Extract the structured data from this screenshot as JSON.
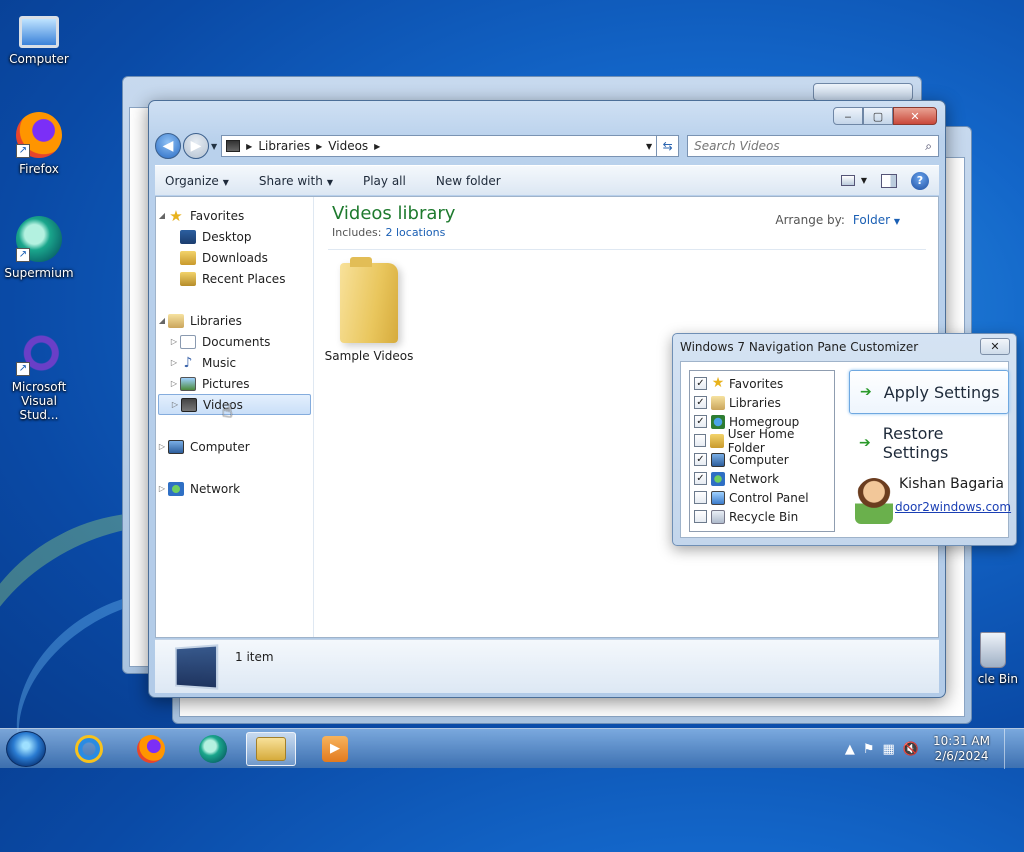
{
  "desktop": {
    "icons": [
      {
        "label": "Computer",
        "icon": "computer-icon"
      },
      {
        "label": "Firefox",
        "icon": "firefox-icon"
      },
      {
        "label": "Supermium",
        "icon": "supermium-icon"
      },
      {
        "label": "Microsoft Visual Stud...",
        "icon": "visual-studio-icon"
      }
    ],
    "recycle_bin_label": "cle Bin"
  },
  "explorer": {
    "breadcrumbs": [
      "Libraries",
      "Videos"
    ],
    "search_placeholder": "Search Videos",
    "toolbar": {
      "organize": "Organize",
      "share_with": "Share with",
      "play_all": "Play all",
      "new_folder": "New folder"
    },
    "nav": {
      "favorites": "Favorites",
      "desktop": "Desktop",
      "downloads": "Downloads",
      "recent_places": "Recent Places",
      "libraries": "Libraries",
      "documents": "Documents",
      "music": "Music",
      "pictures": "Pictures",
      "videos": "Videos",
      "computer": "Computer",
      "network": "Network"
    },
    "library_title": "Videos library",
    "includes_label": "Includes:",
    "includes_link": "2 locations",
    "arrange_label": "Arrange by:",
    "arrange_value": "Folder",
    "items": [
      {
        "name": "Sample Videos"
      }
    ],
    "status": "1 item"
  },
  "customizer": {
    "title": "Windows 7 Navigation Pane Customizer",
    "options": [
      {
        "label": "Favorites",
        "checked": true
      },
      {
        "label": "Libraries",
        "checked": true
      },
      {
        "label": "Homegroup",
        "checked": true
      },
      {
        "label": "User Home Folder",
        "checked": false
      },
      {
        "label": "Computer",
        "checked": true
      },
      {
        "label": "Network",
        "checked": true
      },
      {
        "label": "Control Panel",
        "checked": false
      },
      {
        "label": "Recycle Bin",
        "checked": false
      }
    ],
    "apply_label": "Apply Settings",
    "restore_label": "Restore Settings",
    "author_name": "Kishan Bagaria",
    "author_link": "door2windows.com"
  },
  "taskbar": {
    "time": "10:31 AM",
    "date": "2/6/2024"
  },
  "colors": {
    "library_title": "#1e7a2e",
    "link": "#1a5fb4",
    "close_button": "#c9483a"
  }
}
